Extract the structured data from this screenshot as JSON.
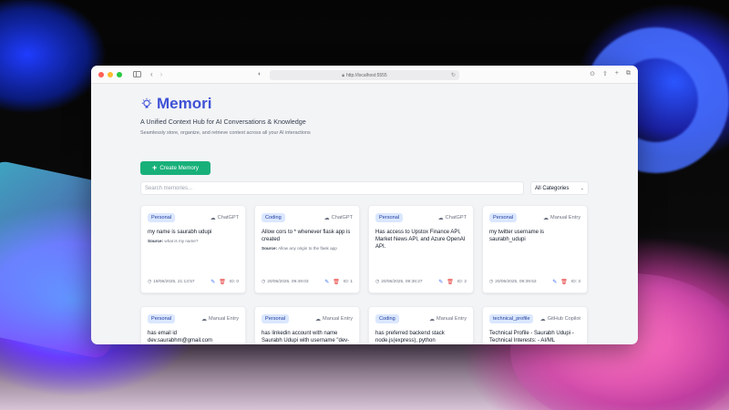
{
  "browser": {
    "url": "http://localhost:5555"
  },
  "app": {
    "title": "Memori",
    "subtitle": "A Unified Context Hub for AI Conversations & Knowledge",
    "tagline": "Seamlessly store, organize, and retrieve context across all your AI interactions",
    "create_label": "Create Memory",
    "search_placeholder": "Search memories...",
    "category_selected": "All Categories",
    "accent_color": "#3f51d6",
    "button_color": "#18b07a"
  },
  "cards": [
    {
      "category": "Personal",
      "source": "ChatGPT",
      "text": "my name is saurabh udupi",
      "src_label": "Source:",
      "src_text": "what is my name?",
      "date": "19/06/2025, 21:13:57",
      "id": "ID: 0"
    },
    {
      "category": "Coding",
      "source": "ChatGPT",
      "text": "Allow cors to * whenever flask app is created",
      "src_label": "Source:",
      "src_text": "Allow any origin to the flask app",
      "date": "20/06/2025, 09:49:03",
      "id": "ID: 1"
    },
    {
      "category": "Personal",
      "source": "ChatGPT",
      "text": "Has access to Upstox Finance API, Market News API, and Azure OpenAI API.",
      "date": "20/06/2025, 09:36:27",
      "id": "ID: 2"
    },
    {
      "category": "Personal",
      "source": "Manual Entry",
      "text": "my twitter username is saurabh_udupi",
      "date": "20/06/2025, 09:39:53",
      "id": "ID: 3"
    },
    {
      "category": "Personal",
      "source": "Manual Entry",
      "text": "has email id dev.saurabhm@gmail.com"
    },
    {
      "category": "Personal",
      "source": "Manual Entry",
      "text": "has linkedin account with name Saurabh Udupi with username \"dev-saurabh\""
    },
    {
      "category": "Coding",
      "source": "Manual Entry",
      "text": "has preferred backend stack node.js(express), python"
    },
    {
      "category": "technical_profile",
      "source": "GitHub Copilot",
      "text": "Technical Profile - Saurabh Udupi - Technical Interests: - AI/ML (evidenced by Azure OpenAI API usage) - Financial Technology"
    }
  ]
}
